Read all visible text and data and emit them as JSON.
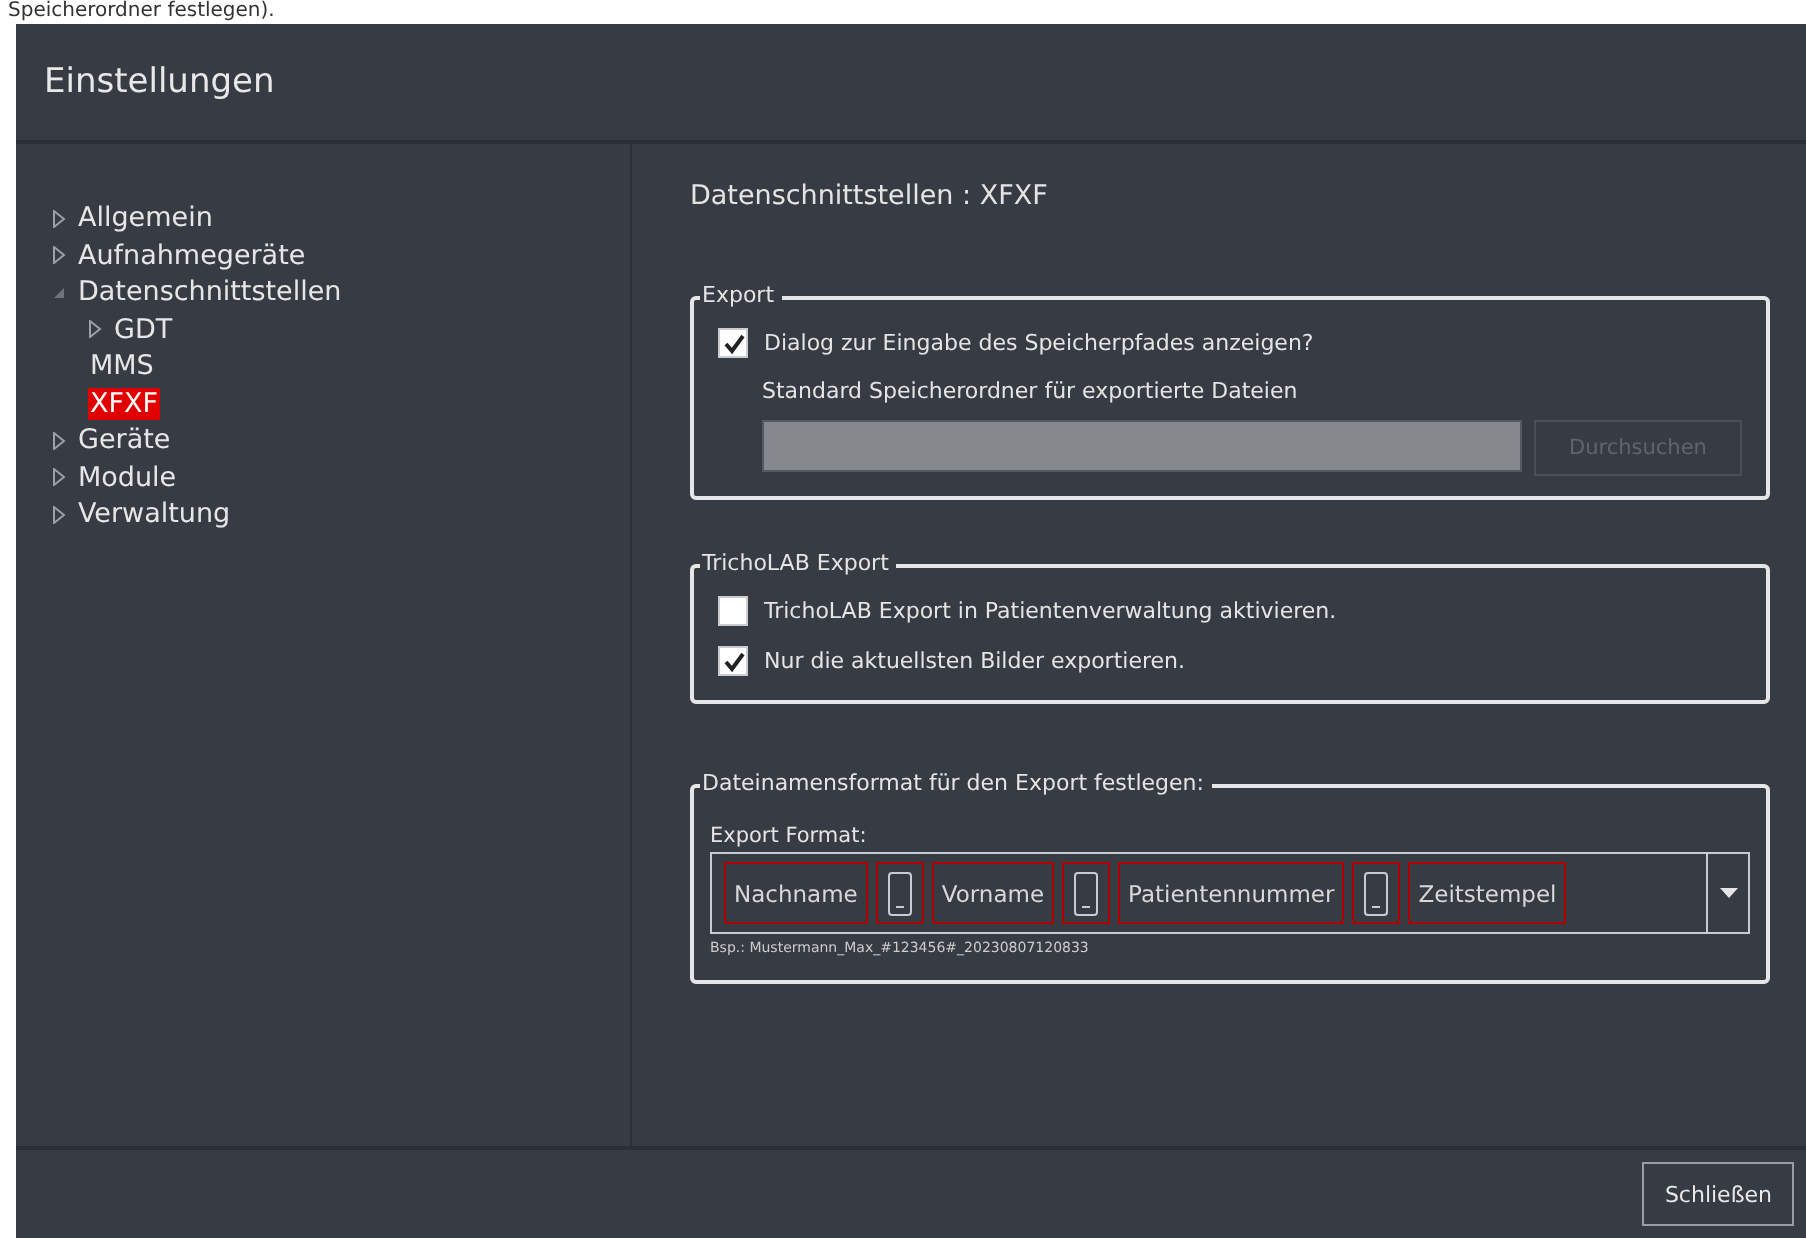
{
  "background_text": "Speicherordner festlegen).",
  "window": {
    "title": "Einstellungen"
  },
  "sidebar": {
    "items": [
      {
        "label": "Allgemein",
        "expanded": false,
        "selected": false
      },
      {
        "label": "Aufnahmegeräte",
        "expanded": false,
        "selected": false
      },
      {
        "label": "Datenschnittstellen",
        "expanded": true,
        "selected": false,
        "children": [
          {
            "label": "GDT",
            "expanded": false,
            "selected": false
          },
          {
            "label": "MMS",
            "selected": false
          },
          {
            "label": "XFXF",
            "selected": true
          }
        ]
      },
      {
        "label": "Geräte",
        "expanded": false,
        "selected": false
      },
      {
        "label": "Module",
        "expanded": false,
        "selected": false
      },
      {
        "label": "Verwaltung",
        "expanded": false,
        "selected": false
      }
    ]
  },
  "content": {
    "heading": "Datenschnittstellen : XFXF",
    "export": {
      "legend": "Export",
      "checkbox": {
        "label": "Dialog zur Eingabe des Speicherpfades anzeigen?",
        "checked": true
      },
      "folder_label": "Standard Speicherordner für exportierte Dateien",
      "browse_button": {
        "label": "Durchsuchen",
        "disabled": true
      }
    },
    "tricholab": {
      "legend": "TrichoLAB Export",
      "checkboxes": [
        {
          "label": "TrichoLAB Export in Patientenverwaltung aktivieren.",
          "checked": false
        },
        {
          "label": "Nur die aktuellsten Bilder exportieren.",
          "checked": true
        }
      ]
    },
    "filename": {
      "legend": "Dateinamensformat für den Export festlegen:",
      "format_label": "Export Format:",
      "tokens": [
        {
          "kind": "text",
          "label": "Nachname"
        },
        {
          "kind": "separator"
        },
        {
          "kind": "text",
          "label": "Vorname"
        },
        {
          "kind": "separator"
        },
        {
          "kind": "text",
          "label": "Patientennummer"
        },
        {
          "kind": "separator"
        },
        {
          "kind": "text",
          "label": "Zeitstempel"
        }
      ],
      "example": "Bsp.:  Mustermann_Max_#123456#_20230807120833"
    }
  },
  "buttons": [
    {
      "label": "Schließen"
    }
  ]
}
